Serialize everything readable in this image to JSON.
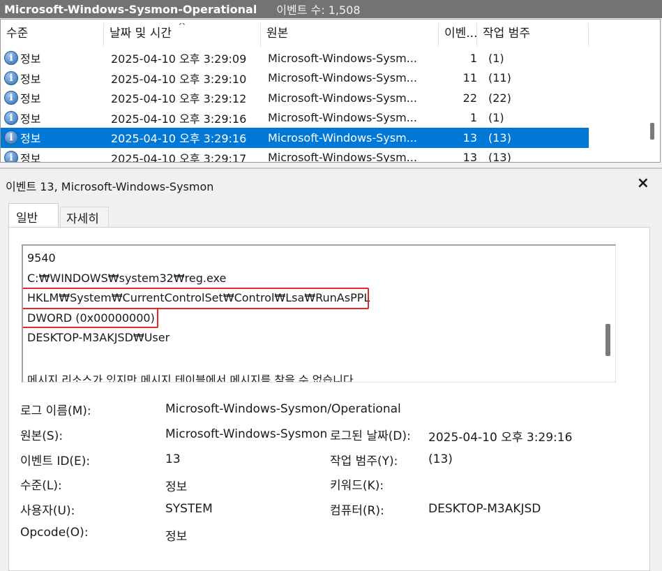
{
  "titlebar": {
    "log_name": "Microsoft-Windows-Sysmon-Operational",
    "event_count": "이벤트 수: 1,508"
  },
  "columns": [
    "수준",
    "날짜 및 시간",
    "원본",
    "이벤...",
    "작업 범주"
  ],
  "sort_indicator": "^",
  "rows": [
    {
      "level": "정보",
      "datetime": "2025-04-10 오후 3:29:09",
      "source": "Microsoft-Windows-Sysm...",
      "event_id": "1",
      "category": "(1)"
    },
    {
      "level": "정보",
      "datetime": "2025-04-10 오후 3:29:10",
      "source": "Microsoft-Windows-Sysm...",
      "event_id": "11",
      "category": "(11)"
    },
    {
      "level": "정보",
      "datetime": "2025-04-10 오후 3:29:12",
      "source": "Microsoft-Windows-Sysm...",
      "event_id": "22",
      "category": "(22)"
    },
    {
      "level": "정보",
      "datetime": "2025-04-10 오후 3:29:16",
      "source": "Microsoft-Windows-Sysm...",
      "event_id": "1",
      "category": "(1)"
    },
    {
      "level": "정보",
      "datetime": "2025-04-10 오후 3:29:16",
      "source": "Microsoft-Windows-Sysm...",
      "event_id": "13",
      "category": "(13)",
      "selected": true
    },
    {
      "level": "정보",
      "datetime": "2025-04-10 오후 3:29:17",
      "source": "Microsoft-Windows-Sysm...",
      "event_id": "13",
      "category": "(13)"
    }
  ],
  "detail": {
    "title": "이벤트 13, Microsoft-Windows-Sysmon",
    "close_glyph": "×",
    "tabs": [
      "일반",
      "자세히"
    ],
    "message_lines": [
      "9540",
      "C:₩WINDOWS₩system32₩reg.exe",
      "HKLM₩System₩CurrentControlSet₩Control₩Lsa₩RunAsPPL",
      "DWORD (0x00000000)",
      "DESKTOP-M3AKJSD₩User",
      "",
      "메시지 리소스가 있지만 메시지 테이블에서 메시지를 찾을 수 없습니다"
    ],
    "highlight_color": "#e0282e",
    "properties": {
      "log_name_label": "로그 이름(M):",
      "log_name_value": "Microsoft-Windows-Sysmon/Operational",
      "source_label": "원본(S):",
      "source_value": "Microsoft-Windows-Sysmon",
      "logged_label": "로그된 날짜(D):",
      "logged_value": "2025-04-10 오후 3:29:16",
      "event_id_label": "이벤트 ID(E):",
      "event_id_value": "13",
      "task_label": "작업 범주(Y):",
      "task_value": "(13)",
      "level_label": "수준(L):",
      "level_value": "정보",
      "keywords_label": "키워드(K):",
      "keywords_value": "",
      "user_label": "사용자(U):",
      "user_value": "SYSTEM",
      "computer_label": "컴퓨터(R):",
      "computer_value": "DESKTOP-M3AKJSD",
      "opcode_label": "Opcode(O):",
      "opcode_value": "정보"
    }
  }
}
